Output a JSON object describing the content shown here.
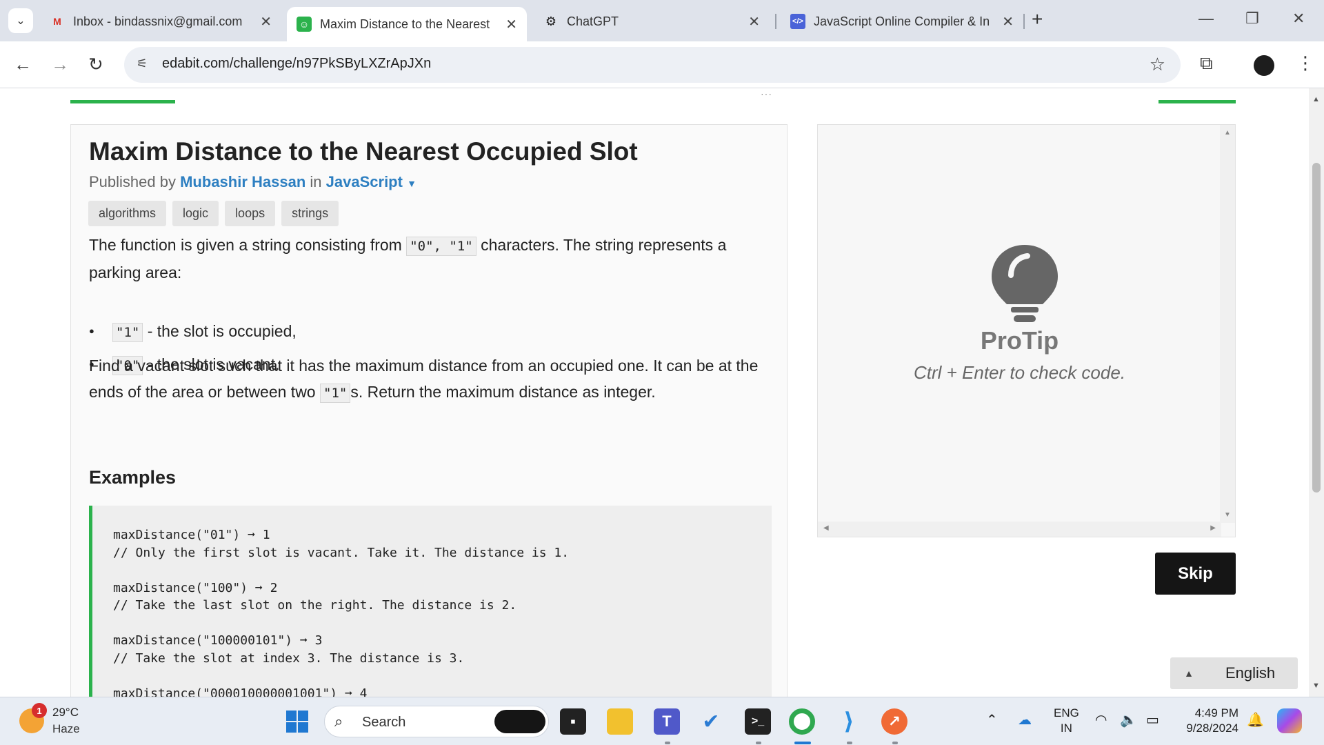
{
  "browser": {
    "tabs": [
      {
        "title": "Inbox - bindassnix@gmail.com",
        "icon": "gmail-icon"
      },
      {
        "title": "Maxim Distance to the Nearest",
        "icon": "edabit-icon"
      },
      {
        "title": "ChatGPT",
        "icon": "chatgpt-icon"
      },
      {
        "title": "JavaScript Online Compiler & In",
        "icon": "code-icon"
      }
    ],
    "url": "edabit.com/challenge/n97PkSByLXZrApJXn"
  },
  "challenge": {
    "title": "Maxim Distance to the Nearest Occupied Slot",
    "published_prefix": "Published by",
    "author": "Mubashir Hassan",
    "in_word": "in",
    "language": "JavaScript",
    "tags": [
      "algorithms",
      "logic",
      "loops",
      "strings"
    ],
    "desc_1_pre": "The function is given a string consisting from",
    "desc_1_code": "\"0\", \"1\"",
    "desc_1_post": "characters. The string represents a parking area:",
    "bullets": [
      {
        "code": "\"1\"",
        "text": "- the slot is occupied,"
      },
      {
        "code": "\"0\"",
        "text": "- the slot is vacant."
      }
    ],
    "desc_2_pre": "Find a vacant slot such that it has the maximum distance from an occupied one. It can be at the ends of the area or between two",
    "desc_2_code": "\"1\"",
    "desc_2_post": "s. Return the maximum distance as integer.",
    "examples_heading": "Examples",
    "examples": [
      {
        "call": "maxDistance(\"01\") ➞ 1",
        "comment": "// Only the first slot is vacant. Take it. The distance is 1."
      },
      {
        "call": "maxDistance(\"100\") ➞ 2",
        "comment": "// Take the last slot on the right. The distance is 2."
      },
      {
        "call": "maxDistance(\"100000101\") ➞ 3",
        "comment": "// Take the slot at index 3. The distance is 3."
      },
      {
        "call": "maxDistance(\"000010000001001\") ➞ 4",
        "comment": ""
      }
    ]
  },
  "protip": {
    "title": "ProTip",
    "text": "Ctrl + Enter to check code."
  },
  "actions": {
    "skip_label": "Skip",
    "language_select": "English"
  },
  "taskbar": {
    "weather_temp": "29°C",
    "weather_cond": "Haze",
    "weather_badge": "1",
    "search_label": "Search",
    "lang_line1": "ENG",
    "lang_line2": "IN",
    "time": "4:49 PM",
    "date": "9/28/2024"
  },
  "colors": {
    "accent_green": "#2bb24c",
    "link_blue": "#2d7fc1",
    "skip_bg": "#151515"
  }
}
